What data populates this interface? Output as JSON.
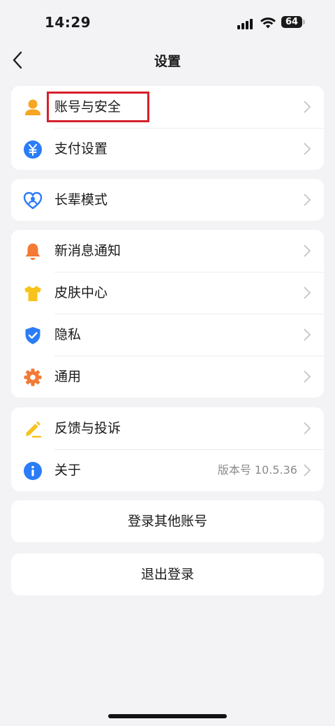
{
  "status_bar": {
    "time": "14:29",
    "battery": "64"
  },
  "nav": {
    "title": "设置"
  },
  "groups": {
    "account": {
      "rows": [
        {
          "label": "账号与安全",
          "icon": "person-icon"
        },
        {
          "label": "支付设置",
          "icon": "yuan-icon"
        }
      ]
    },
    "elder": {
      "rows": [
        {
          "label": "长辈模式",
          "icon": "heart-person-icon"
        }
      ]
    },
    "prefs": {
      "rows": [
        {
          "label": "新消息通知",
          "icon": "bell-icon"
        },
        {
          "label": "皮肤中心",
          "icon": "tshirt-icon"
        },
        {
          "label": "隐私",
          "icon": "shield-check-icon"
        },
        {
          "label": "通用",
          "icon": "gear-icon"
        }
      ]
    },
    "about": {
      "rows": [
        {
          "label": "反馈与投诉",
          "icon": "pencil-icon"
        },
        {
          "label": "关于",
          "icon": "info-icon",
          "value": "版本号 10.5.36"
        }
      ]
    }
  },
  "buttons": {
    "switch_account": "登录其他账号",
    "logout": "退出登录"
  },
  "colors": {
    "accent_blue": "#2b7cf6",
    "orange": "#f5a623",
    "bell_orange": "#f27a35",
    "yellow": "#f7c21b",
    "highlight_red": "#d6202b",
    "background": "#f3f3f5"
  }
}
